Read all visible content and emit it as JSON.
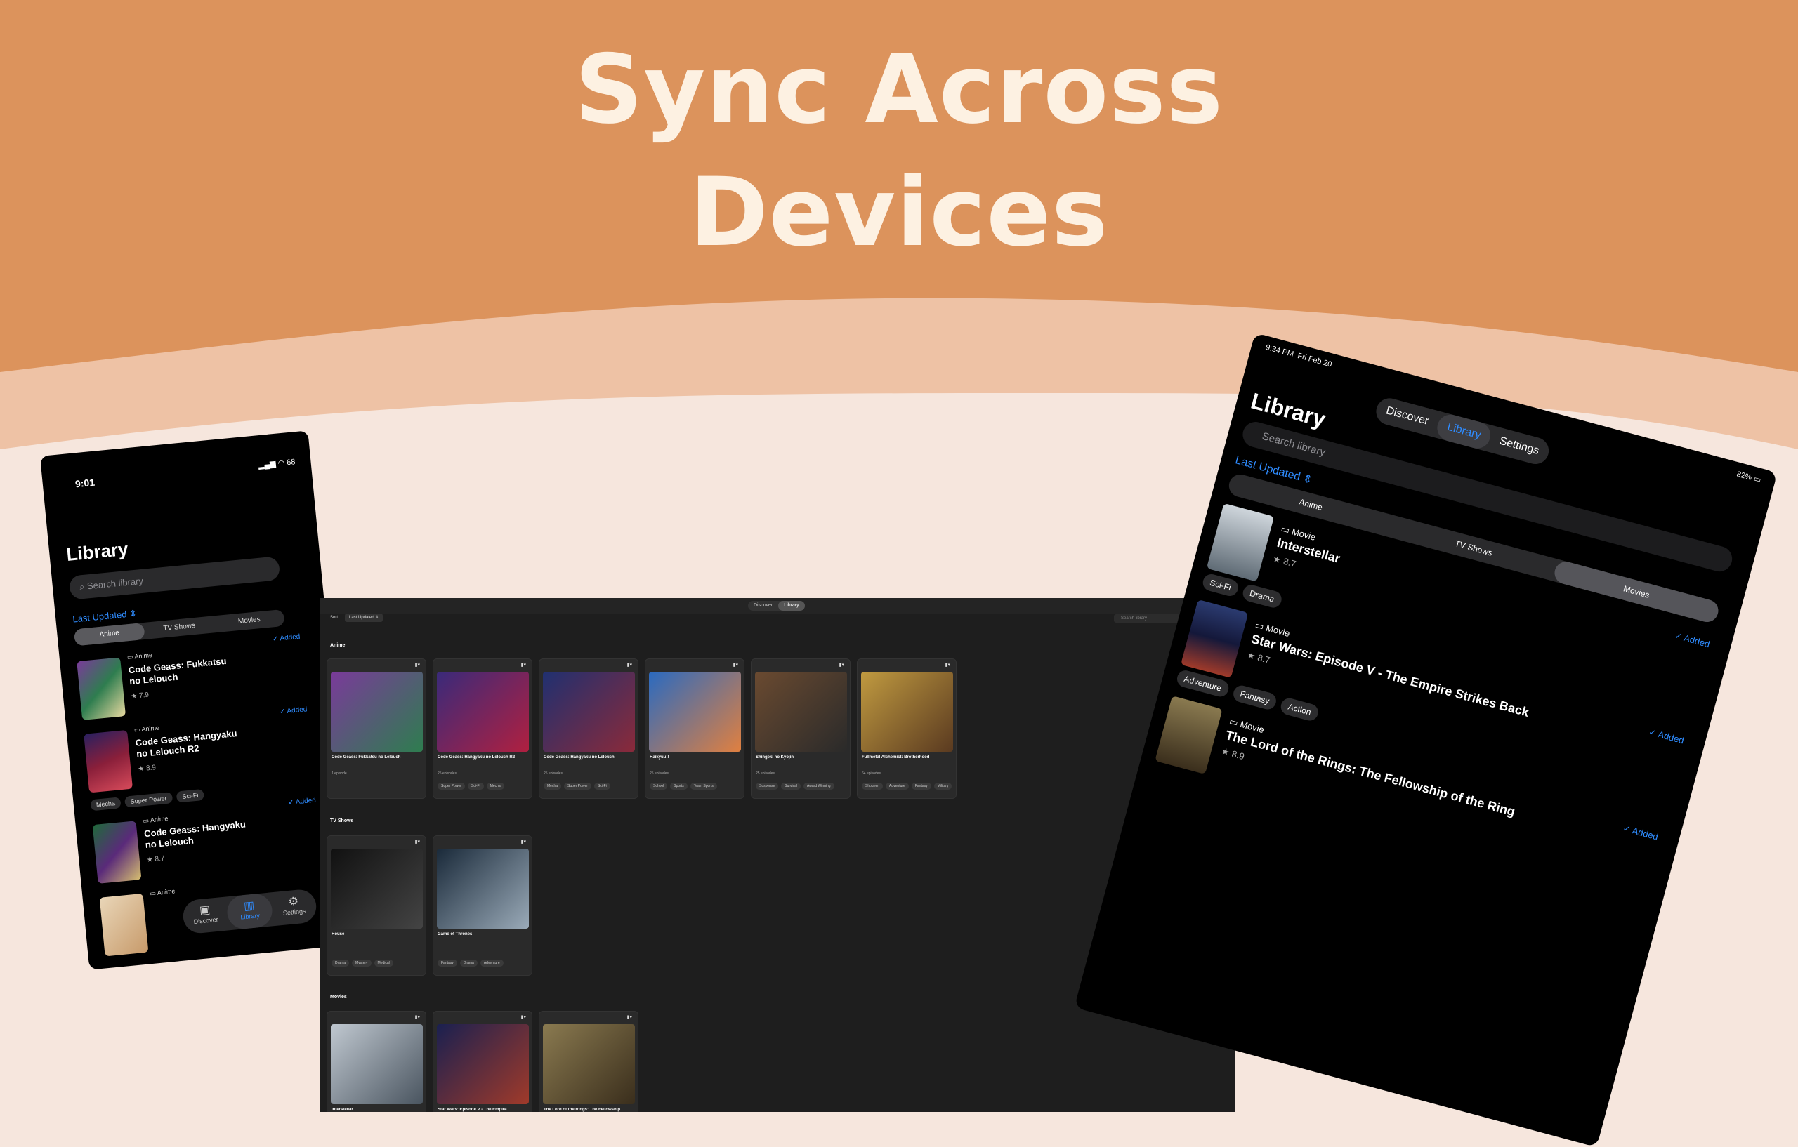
{
  "headline": {
    "line1": "Sync Across",
    "line2": "Devices"
  },
  "colors": {
    "top_band": "#dc935c",
    "middle_band": "#eec2a5",
    "bottom_bg": "#f6e6dd",
    "accent": "#2f8cff"
  },
  "phone": {
    "time": "9:01",
    "battery": "68",
    "title": "Library",
    "search_placeholder": "Search library",
    "sort_label": "Last Updated",
    "segments": [
      "Anime",
      "TV Shows",
      "Movies"
    ],
    "items": [
      {
        "kind": "Anime",
        "title": "Code Geass: Fukkatsu no Lelouch",
        "rating": "7.9",
        "added": "Added",
        "tags": []
      },
      {
        "kind": "Anime",
        "title": "Code Geass: Hangyaku no Lelouch R2",
        "rating": "8.9",
        "added": "Added",
        "tags": [
          "Mecha",
          "Super Power",
          "Sci-Fi"
        ]
      },
      {
        "kind": "Anime",
        "title": "Code Geass: Hangyaku no Lelouch",
        "rating": "8.7",
        "added": "Added",
        "tags": []
      },
      {
        "kind": "Anime",
        "title": "",
        "rating": "",
        "added": "",
        "tags": []
      }
    ],
    "tabbar": [
      "Discover",
      "Library",
      "Settings"
    ]
  },
  "desktop": {
    "segments": [
      "Discover",
      "Library"
    ],
    "sort_label": "Sort",
    "sort_value": "Last Updated",
    "search_placeholder": "Search library",
    "sections": [
      {
        "title": "Anime",
        "cards": [
          {
            "title": "Code Geass: Fukkatsu no Lelouch",
            "episodes": "1 episode",
            "tags": []
          },
          {
            "title": "Code Geass: Hangyaku no Lelouch R2",
            "episodes": "25 episodes",
            "tags": [
              "Super Power",
              "Sci-Fi",
              "Mecha"
            ]
          },
          {
            "title": "Code Geass: Hangyaku no Lelouch",
            "episodes": "25 episodes",
            "tags": [
              "Mecha",
              "Super Power",
              "Sci-Fi"
            ]
          },
          {
            "title": "Haikyuu!!",
            "episodes": "25 episodes",
            "tags": [
              "School",
              "Sports",
              "Team Sports"
            ]
          },
          {
            "title": "Shingeki no Kyojin",
            "episodes": "25 episodes",
            "tags": [
              "Suspense",
              "Survival",
              "Award Winning"
            ]
          },
          {
            "title": "Fullmetal Alchemist: Brotherhood",
            "episodes": "64 episodes",
            "tags": [
              "Shounen",
              "Adventure",
              "Fantasy",
              "Military"
            ]
          }
        ]
      },
      {
        "title": "TV Shows",
        "cards": [
          {
            "title": "House",
            "episodes": "",
            "tags": [
              "Drama",
              "Mystery",
              "Medical"
            ]
          },
          {
            "title": "Game of Thrones",
            "episodes": "",
            "tags": [
              "Fantasy",
              "Drama",
              "Adventure"
            ]
          }
        ]
      },
      {
        "title": "Movies",
        "cards": [
          {
            "title": "Interstellar",
            "episodes": "",
            "tags": []
          },
          {
            "title": "Star Wars: Episode V - The Empire",
            "episodes": "",
            "tags": []
          },
          {
            "title": "The Lord of the Rings: The Fellowship",
            "episodes": "",
            "tags": []
          }
        ]
      }
    ]
  },
  "tablet": {
    "time": "9:34 PM",
    "date": "Fri Feb 20",
    "battery": "82%",
    "title": "Library",
    "tabs": [
      "Discover",
      "Library",
      "Settings"
    ],
    "search_placeholder": "Search library",
    "sort_label": "Last Updated",
    "segments": [
      "Anime",
      "TV Shows",
      "Movies"
    ],
    "items": [
      {
        "kind": "Movie",
        "title": "Interstellar",
        "rating": "8.7",
        "added": "Added",
        "tags": [
          "Sci-Fi",
          "Drama"
        ]
      },
      {
        "kind": "Movie",
        "title": "Star Wars: Episode V - The Empire Strikes Back",
        "rating": "8.7",
        "added": "Added",
        "tags": [
          "Adventure",
          "Fantasy",
          "Action"
        ]
      },
      {
        "kind": "Movie",
        "title": "The Lord of the Rings: The Fellowship of the Ring",
        "rating": "8.9",
        "added": "Added",
        "tags": []
      }
    ]
  }
}
